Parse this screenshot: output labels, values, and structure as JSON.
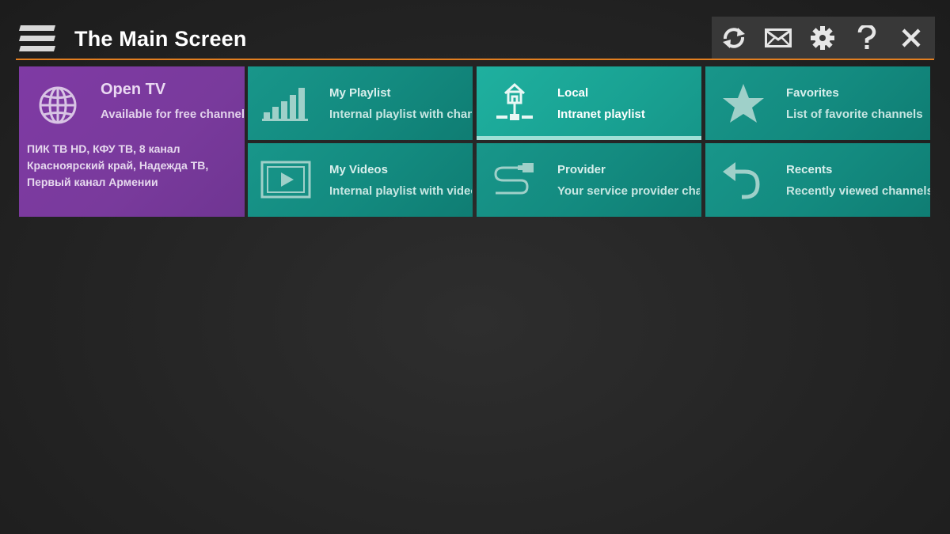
{
  "header": {
    "title": "The Main Screen",
    "menu_icon": "hamburger-menu-icon",
    "accent_color": "#e27e1f"
  },
  "toolbar": {
    "buttons": [
      {
        "name": "refresh",
        "icon": "refresh-icon"
      },
      {
        "name": "messages",
        "icon": "envelope-icon"
      },
      {
        "name": "settings",
        "icon": "gear-icon"
      },
      {
        "name": "help",
        "icon": "question-icon"
      },
      {
        "name": "close",
        "icon": "close-icon"
      }
    ]
  },
  "tiles": {
    "open_tv": {
      "title": "Open TV",
      "subtitle": "Available for free channels",
      "channels": "ПИК ТВ HD, КФУ ТВ, 8 канал Красноярский край, Надежда ТВ, Первый канал Армении",
      "icon": "globe-icon",
      "color": "#7d3aa2"
    },
    "my_playlist": {
      "title": "My Playlist",
      "subtitle": "Internal playlist with chan",
      "icon": "signal-bars-icon"
    },
    "local": {
      "title": "Local",
      "subtitle": "Intranet playlist",
      "icon": "home-network-icon",
      "selected": true
    },
    "favorites": {
      "title": "Favorites",
      "subtitle": "List of favorite channels",
      "icon": "star-icon"
    },
    "my_videos": {
      "title": "My Videos",
      "subtitle": "Internal playlist with video",
      "icon": "video-play-icon"
    },
    "provider": {
      "title": "Provider",
      "subtitle": "Your service provider chan",
      "icon": "cable-plug-icon"
    },
    "recents": {
      "title": "Recents",
      "subtitle": "Recently viewed channels",
      "icon": "undo-arrow-icon"
    }
  },
  "colors": {
    "tile_teal": "#138a7f",
    "tile_teal_active": "#1aa594",
    "tile_purple": "#7d3aa2"
  }
}
